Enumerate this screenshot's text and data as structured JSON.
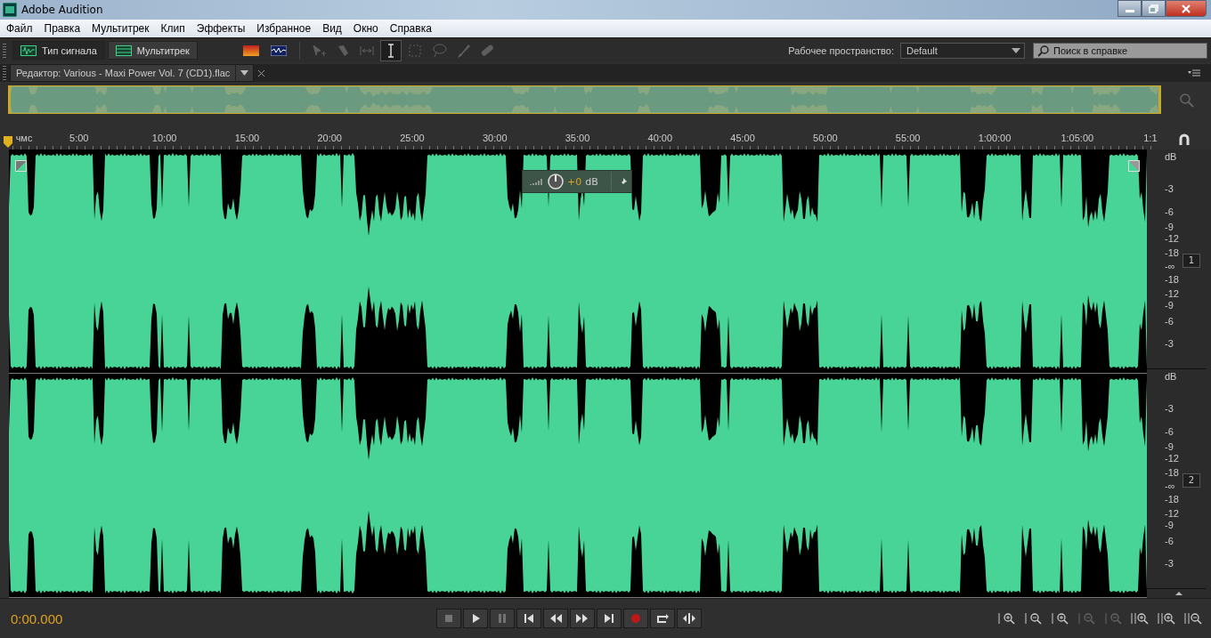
{
  "window": {
    "title": "Adobe Audition"
  },
  "menu": [
    "Файл",
    "Правка",
    "Мультитрек",
    "Клип",
    "Эффекты",
    "Избранное",
    "Вид",
    "Окно",
    "Справка"
  ],
  "view_buttons": [
    {
      "label": "Тип сигнала",
      "selected": true
    },
    {
      "label": "Мультитрек",
      "selected": false
    }
  ],
  "tools": [
    {
      "kind": "move",
      "selected": false
    },
    {
      "kind": "razor",
      "selected": false
    },
    {
      "kind": "slip",
      "selected": false
    },
    {
      "kind": "time",
      "selected": true
    },
    {
      "kind": "marquee",
      "selected": false
    },
    {
      "kind": "lasso",
      "selected": false
    },
    {
      "kind": "brush",
      "selected": false
    },
    {
      "kind": "heal",
      "selected": false
    }
  ],
  "workspace": {
    "label": "Рабочее пространство:",
    "value": "Default"
  },
  "search": {
    "placeholder": "Поиск в справке"
  },
  "editor_tab": {
    "title": "Редактор: Various - Maxi Power Vol. 7 (CD1).flac"
  },
  "ruler": [
    "чмс",
    "5:00",
    "10:00",
    "15:00",
    "20:00",
    "25:00",
    "30:00",
    "35:00",
    "40:00",
    "45:00",
    "50:00",
    "55:00",
    "1:00:00",
    "1:05:00",
    "1:1"
  ],
  "hud": {
    "gain": "+0",
    "unit": "dB"
  },
  "channels": [
    {
      "number": "1",
      "scale": [
        "dB",
        "-3",
        "-6",
        "-9",
        "-12",
        "-18",
        "-∞",
        "-18",
        "-12",
        "-9",
        "-6",
        "-3"
      ]
    },
    {
      "number": "2",
      "scale": [
        "dB",
        "-3",
        "-6",
        "-9",
        "-12",
        "-18",
        "-∞",
        "-18",
        "-12",
        "-9",
        "-6",
        "-3"
      ]
    }
  ],
  "time": "0:00.000",
  "transport": [
    {
      "kind": "stop",
      "disabled": true
    },
    {
      "kind": "play",
      "disabled": false
    },
    {
      "kind": "pause",
      "disabled": true
    },
    {
      "kind": "start",
      "disabled": false
    },
    {
      "kind": "rewind",
      "disabled": false
    },
    {
      "kind": "forward",
      "disabled": false
    },
    {
      "kind": "end",
      "disabled": false
    },
    {
      "kind": "record",
      "disabled": false
    },
    {
      "kind": "loop",
      "disabled": false
    },
    {
      "kind": "skip",
      "disabled": false
    }
  ],
  "zoom": [
    {
      "kind": "in-amp",
      "disabled": false
    },
    {
      "kind": "out-amp",
      "disabled": false
    },
    {
      "kind": "in-time",
      "disabled": false
    },
    {
      "kind": "out-full",
      "disabled": true
    },
    {
      "kind": "selection",
      "disabled": true
    },
    {
      "kind": "in-left",
      "disabled": false
    },
    {
      "kind": "in-right",
      "disabled": false
    },
    {
      "kind": "out-both",
      "disabled": false
    }
  ]
}
